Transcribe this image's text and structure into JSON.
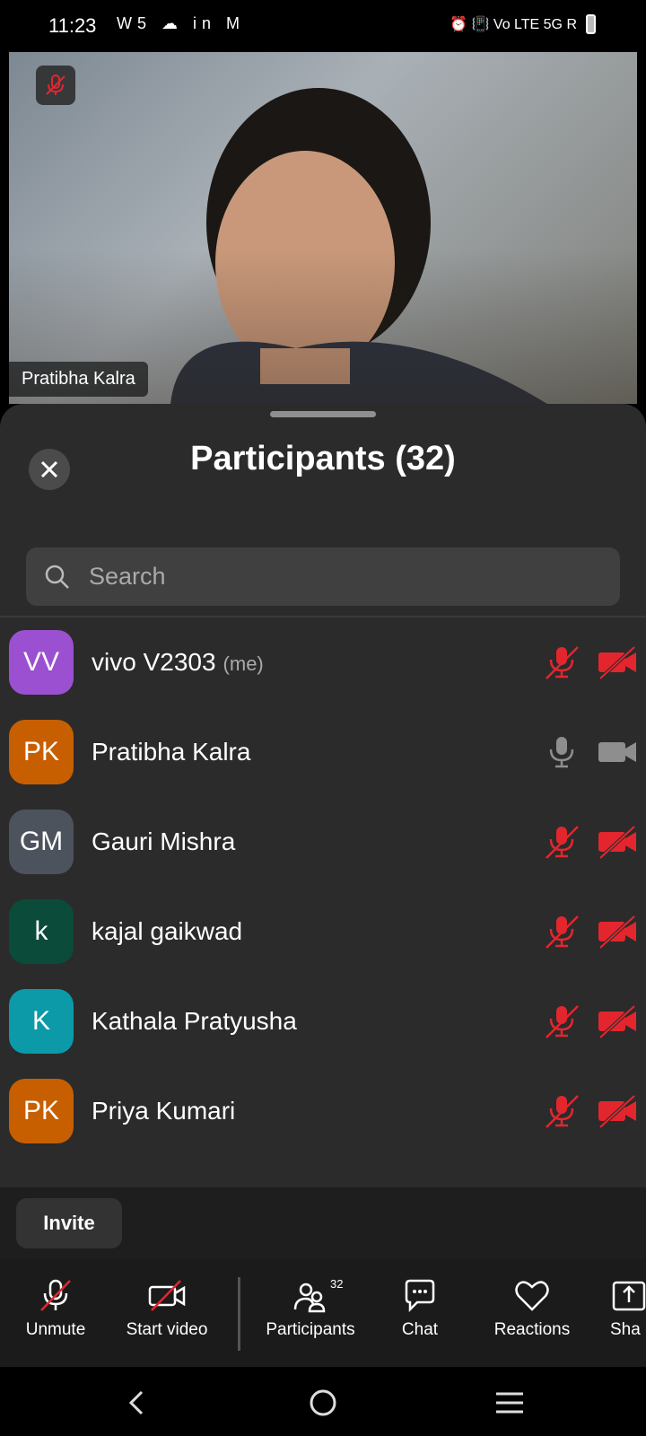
{
  "status_bar": {
    "time": "11:23",
    "apps": "W5 ☁ in M",
    "right": "⏰ 📳 Vo LTE 5G R"
  },
  "video": {
    "participant_name": "Pratibha Kalra"
  },
  "sheet": {
    "title": "Participants (32)",
    "search_placeholder": "Search",
    "participants": [
      {
        "initials": "VV",
        "name": "vivo V2303",
        "suffix": "(me)",
        "color": "#9a50d0",
        "mic": "muted",
        "cam": "off"
      },
      {
        "initials": "PK",
        "name": "Pratibha Kalra",
        "suffix": "",
        "color": "#c75f00",
        "mic": "on",
        "cam": "on"
      },
      {
        "initials": "GM",
        "name": "Gauri Mishra",
        "suffix": "",
        "color": "#4d535c",
        "mic": "muted",
        "cam": "off"
      },
      {
        "initials": "k",
        "name": "kajal gaikwad",
        "suffix": "",
        "color": "#0a4b3a",
        "mic": "muted",
        "cam": "off"
      },
      {
        "initials": "K",
        "name": "Kathala Pratyusha",
        "suffix": "",
        "color": "#0c9aa8",
        "mic": "muted",
        "cam": "off"
      },
      {
        "initials": "PK",
        "name": "Priya Kumari",
        "suffix": "",
        "color": "#c75f00",
        "mic": "muted",
        "cam": "off"
      }
    ],
    "invite_label": "Invite"
  },
  "toolbar": {
    "unmute": "Unmute",
    "start_video": "Start video",
    "participants": "Participants",
    "participants_count": "32",
    "chat": "Chat",
    "reactions": "Reactions",
    "share": "Sha"
  },
  "colors": {
    "muted_red": "#e3262e",
    "sheet_bg": "#2b2b2b"
  }
}
